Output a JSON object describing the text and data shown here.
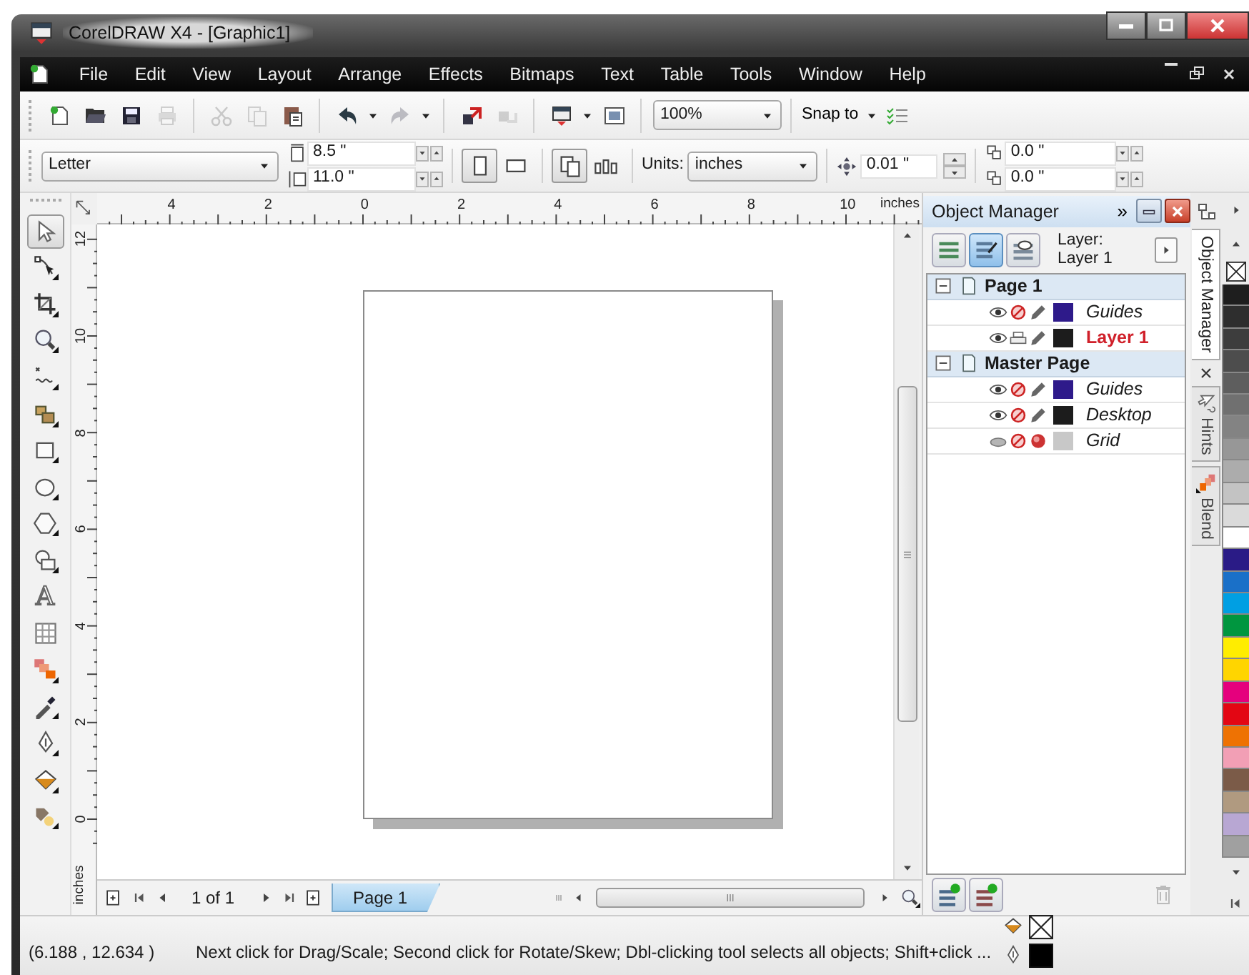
{
  "window": {
    "title": "CorelDRAW X4 - [Graphic1]"
  },
  "menu": [
    "File",
    "Edit",
    "View",
    "Layout",
    "Arrange",
    "Effects",
    "Bitmaps",
    "Text",
    "Table",
    "Tools",
    "Window",
    "Help"
  ],
  "standard_toolbar": {
    "buttons": [
      {
        "disabled": false
      },
      {
        "disabled": false
      },
      {
        "disabled": false
      },
      {
        "disabled": true
      },
      {
        "disabled": true
      },
      {
        "disabled": true
      },
      {
        "disabled": false
      },
      {
        "disabled": false
      },
      {
        "disabled": true
      },
      {
        "disabled": false
      },
      {
        "disabled": true
      },
      {
        "disabled": false
      },
      {
        "disabled": false
      }
    ],
    "zoom": "100%",
    "snap": "Snap to"
  },
  "property_bar": {
    "paper": "Letter",
    "width": "8.5 \"",
    "height": "11.0 \"",
    "orientation": [
      {
        "selected": true
      },
      {
        "selected": false
      }
    ],
    "page_scope": [
      {
        "selected": true
      },
      {
        "selected": false
      }
    ],
    "units_label": "Units:",
    "units": "inches",
    "nudge": "0.01 \"",
    "duplicate_x": "0.0 \"",
    "duplicate_y": "0.0 \""
  },
  "toolbox": [
    {
      "selected": true
    },
    {
      "selected": false
    },
    {
      "selected": false
    },
    {
      "selected": false
    },
    {
      "selected": false
    },
    {
      "selected": false
    },
    {
      "selected": false
    },
    {
      "selected": false
    },
    {
      "selected": false
    },
    {
      "selected": false
    },
    {
      "selected": false,
      "glyph": "A"
    },
    {
      "selected": false
    },
    {
      "selected": false
    },
    {
      "selected": false
    },
    {
      "selected": false
    },
    {
      "selected": false
    },
    {
      "selected": false
    }
  ],
  "rulers": {
    "horizontal": [
      "4",
      "2",
      "0",
      "2",
      "4",
      "6",
      "8",
      "10"
    ],
    "horizontal_unit": "inches",
    "vertical": [
      "12",
      "10",
      "8",
      "6",
      "4",
      "2",
      "0"
    ],
    "vertical_unit": "inches"
  },
  "page_navigator": {
    "count": "1 of 1",
    "tabs": [
      {
        "label": "Page 1",
        "selected": true
      }
    ]
  },
  "object_manager": {
    "title": "Object Manager",
    "expand": "»",
    "layer_label": "Layer:",
    "current_layer": "Layer 1",
    "view_buttons": [
      {
        "selected": false
      },
      {
        "selected": true
      },
      {
        "selected": false
      }
    ],
    "tree": [
      {
        "label": "Page 1",
        "expanded": true,
        "children": [
          {
            "label": "Guides",
            "kind": "special",
            "visible": true,
            "printable": false,
            "editable": true,
            "color": "#2e1a8a",
            "selected": false
          },
          {
            "label": "Layer 1",
            "kind": "layer",
            "visible": true,
            "printable": true,
            "editable": true,
            "color": "#1c1c1c",
            "selected": true
          }
        ]
      },
      {
        "label": "Master Page",
        "expanded": true,
        "children": [
          {
            "label": "Guides",
            "kind": "special",
            "visible": true,
            "printable": false,
            "editable": true,
            "color": "#2e1a8a",
            "selected": false
          },
          {
            "label": "Desktop",
            "kind": "special",
            "visible": true,
            "printable": false,
            "editable": true,
            "color": "#1c1c1c",
            "selected": false
          },
          {
            "label": "Grid",
            "kind": "special",
            "visible": false,
            "printable": false,
            "editable": false,
            "color": "#c8c8c8",
            "selected": false
          }
        ]
      }
    ]
  },
  "dock_tabs": [
    {
      "label": "Object Manager",
      "selected": true
    },
    {
      "label": "Hints",
      "selected": false
    },
    {
      "label": "Blend",
      "selected": false
    }
  ],
  "palette": [
    {
      "color": "#1e1e1e"
    },
    {
      "color": "#2e2e2e"
    },
    {
      "color": "#3d3d3d"
    },
    {
      "color": "#4d4d4d"
    },
    {
      "color": "#5e5e5e"
    },
    {
      "color": "#707070"
    },
    {
      "color": "#838383"
    },
    {
      "color": "#979797"
    },
    {
      "color": "#acacac"
    },
    {
      "color": "#c3c3c3"
    },
    {
      "color": "#dadada"
    },
    {
      "color": "#ffffff"
    },
    {
      "color": "#2a1b86"
    },
    {
      "color": "#1a70c8"
    },
    {
      "color": "#009fe3"
    },
    {
      "color": "#00963f"
    },
    {
      "color": "#ffed00"
    },
    {
      "color": "#ffd500"
    },
    {
      "color": "#e5007d"
    },
    {
      "color": "#e30613"
    },
    {
      "color": "#ee7203"
    },
    {
      "color": "#f29fb5"
    },
    {
      "color": "#7b5b48"
    },
    {
      "color": "#b09a80"
    },
    {
      "color": "#b8a7d3"
    },
    {
      "color": "#a0a0a0"
    }
  ],
  "status_bar": {
    "coordinates": "(6.188 , 12.634 )",
    "message": "Next click for Drag/Scale; Second click for Rotate/Skew; Dbl-clicking tool selects all objects; Shift+click ..."
  }
}
